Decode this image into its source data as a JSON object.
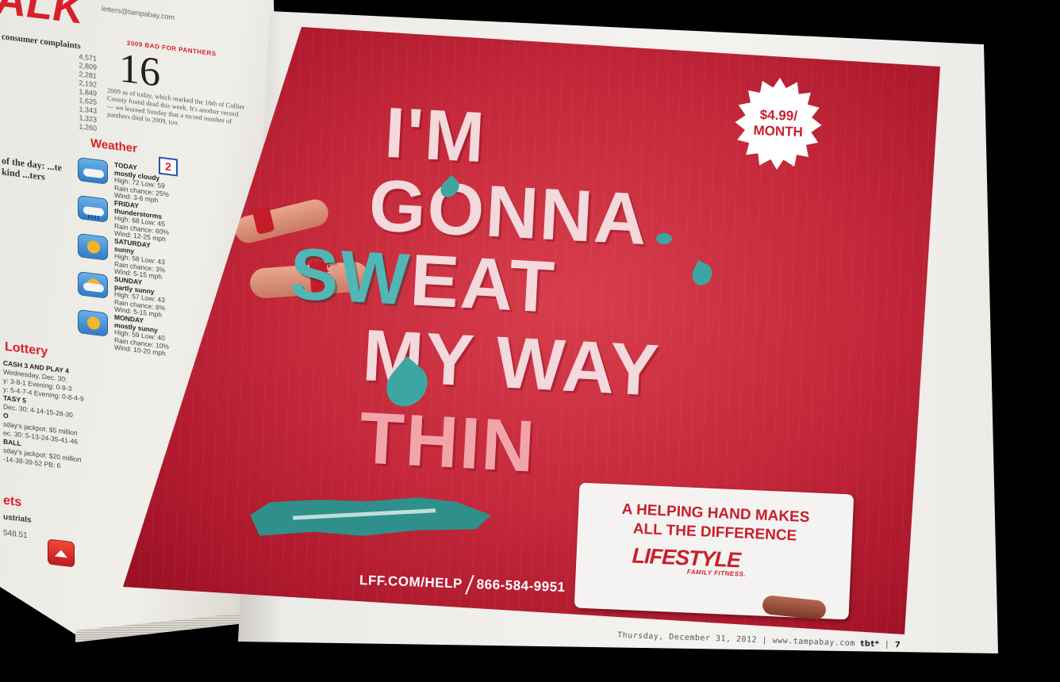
{
  "left_page": {
    "section_title": "ALK",
    "contact": "letters@tampabay.com",
    "complaints_title": "consumer complaints",
    "complaints": [
      {
        "label": "",
        "value": "4,571"
      },
      {
        "label": "",
        "value": "2,809"
      },
      {
        "label": "",
        "value": "2,281"
      },
      {
        "label": "",
        "value": "2,192"
      },
      {
        "label": "",
        "value": "1,849"
      },
      {
        "label": "",
        "value": "1,625"
      },
      {
        "label": "",
        "value": "1,343"
      },
      {
        "label": "",
        "value": "1,323"
      },
      {
        "label": "",
        "value": "1,260"
      }
    ],
    "number_title": "2009 BAD FOR PANTHERS",
    "big_number": "16",
    "number_story": "2009 as of today, which marked the 16th of Collier County found dead this week. It's another record — we learned Sunday that a record number of panthers died in 2009, too.",
    "quote_title": "of the day: ...te kind ...ters",
    "weather_title": "Weather",
    "weather_badge": "2",
    "weather": [
      {
        "day": "TODAY",
        "cond": "mostly cloudy",
        "l1": "High: 72    Low: 59",
        "l2": "Rain chance: 25%",
        "l3": "Wind: 3-6 mph",
        "icon": "cloud"
      },
      {
        "day": "FRIDAY",
        "cond": "thunderstorms",
        "l1": "High: 68    Low: 45",
        "l2": "Rain chance: 60%",
        "l3": "Wind: 12-25 mph",
        "icon": "storm"
      },
      {
        "day": "SATURDAY",
        "cond": "sunny",
        "l1": "High: 58    Low: 43",
        "l2": "Rain chance: 3%",
        "l3": "Wind: 5-15 mph",
        "icon": "sun"
      },
      {
        "day": "SUNDAY",
        "cond": "partly sunny",
        "l1": "High: 57    Low: 43",
        "l2": "Rain chance: 8%",
        "l3": "Wind: 5-15 mph",
        "icon": "partly"
      },
      {
        "day": "MONDAY",
        "cond": "mostly sunny",
        "l1": "High: 59    Low: 40",
        "l2": "Rain chance: 10%",
        "l3": "Wind: 10-20 mph",
        "icon": "sun"
      }
    ],
    "lottery_title": "Lottery",
    "lottery": [
      {
        "text": "CASH 3 AND PLAY 4",
        "bold": true
      },
      {
        "text": "Wednesday, Dec. 30:",
        "bold": false
      },
      {
        "text": "y: 3-8-1        Evening: 0-9-3",
        "bold": false
      },
      {
        "text": "y: 5-4-7-4      Evening: 0-8-4-9",
        "bold": false
      },
      {
        "text": "TASY 5",
        "bold": true
      },
      {
        "text": "Dec. 30:  4-14-15-28-30",
        "bold": false
      },
      {
        "text": "O",
        "bold": true
      },
      {
        "text": "sday's jackpot: $5 million",
        "bold": false
      },
      {
        "text": "ec. 30:  5-13-24-35-41-46",
        "bold": false
      },
      {
        "text": "BALL",
        "bold": true
      },
      {
        "text": "sday's jackpot: $20 million",
        "bold": false
      },
      {
        "text": "-14-38-39-52  PB: 6",
        "bold": false
      }
    ],
    "bets_title": "ets",
    "stock_label": "ustrials",
    "stock_value": "548.51"
  },
  "ad": {
    "price_line1": "$4.99/",
    "price_line2": "MONTH",
    "headline": {
      "line1": "I'M",
      "line2": "GONNA",
      "line3_teal": "SW",
      "line3_rest": "EAT",
      "line4": "MY WAY",
      "line5": "THIN"
    },
    "wristband_text": "LIFESTYLE",
    "card_line1": "A HELPING HAND MAKES",
    "card_line2": "ALL THE DIFFERENCE",
    "logo_main": "LIFESTYLE",
    "logo_sub": "FAMILY FITNESS.",
    "url": "LFF.COM/HELP",
    "phone": "866-584-9951",
    "colors": {
      "red": "#c4283a",
      "teal": "#4fb8b6",
      "brand_red": "#c8202c"
    }
  },
  "folio": {
    "date": "Thursday, December 31, 2012",
    "site": "www.tampabay.com",
    "paper": "tbt*",
    "page": "7"
  }
}
